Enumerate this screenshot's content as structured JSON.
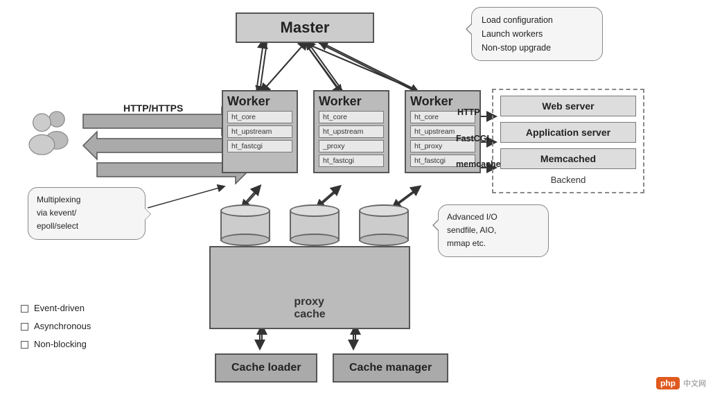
{
  "master": {
    "label": "Master"
  },
  "callout": {
    "lines": [
      "Load configuration",
      "Launch workers",
      "Non-stop upgrade"
    ]
  },
  "workers": [
    {
      "title": "Worker",
      "modules": [
        "ht_core",
        "ht_upstream",
        "ht_fastcgi"
      ]
    },
    {
      "title": "Worker",
      "modules": [
        "ht_core",
        "ht_upstream",
        "_proxy",
        "ht_fastcgi"
      ]
    },
    {
      "title": "Worker",
      "modules": [
        "ht_core",
        "ht_upstream",
        "ht_proxy",
        "ht_fastcgi"
      ]
    }
  ],
  "backend": {
    "title": "Backend",
    "items": [
      "Web server",
      "Application server",
      "Memcached"
    ]
  },
  "conn_labels": {
    "http": "HTTP",
    "fastcgi": "FastCGI",
    "memcache": "memcache",
    "http_https": "HTTP/HTTPS"
  },
  "proxy_cache": {
    "label": "proxy\ncache"
  },
  "cache_loader": {
    "label": "Cache loader"
  },
  "cache_manager": {
    "label": "Cache manager"
  },
  "multiplex": {
    "lines": [
      "Multiplexing",
      "via kevent/",
      "epoll/select"
    ]
  },
  "advio": {
    "lines": [
      "Advanced I/O",
      "sendfile, AIO,",
      "mmap etc."
    ]
  },
  "legend": [
    "Event-driven",
    "Asynchronous",
    "Non-blocking"
  ],
  "php_logo": {
    "badge": "php",
    "site": "中文网"
  }
}
